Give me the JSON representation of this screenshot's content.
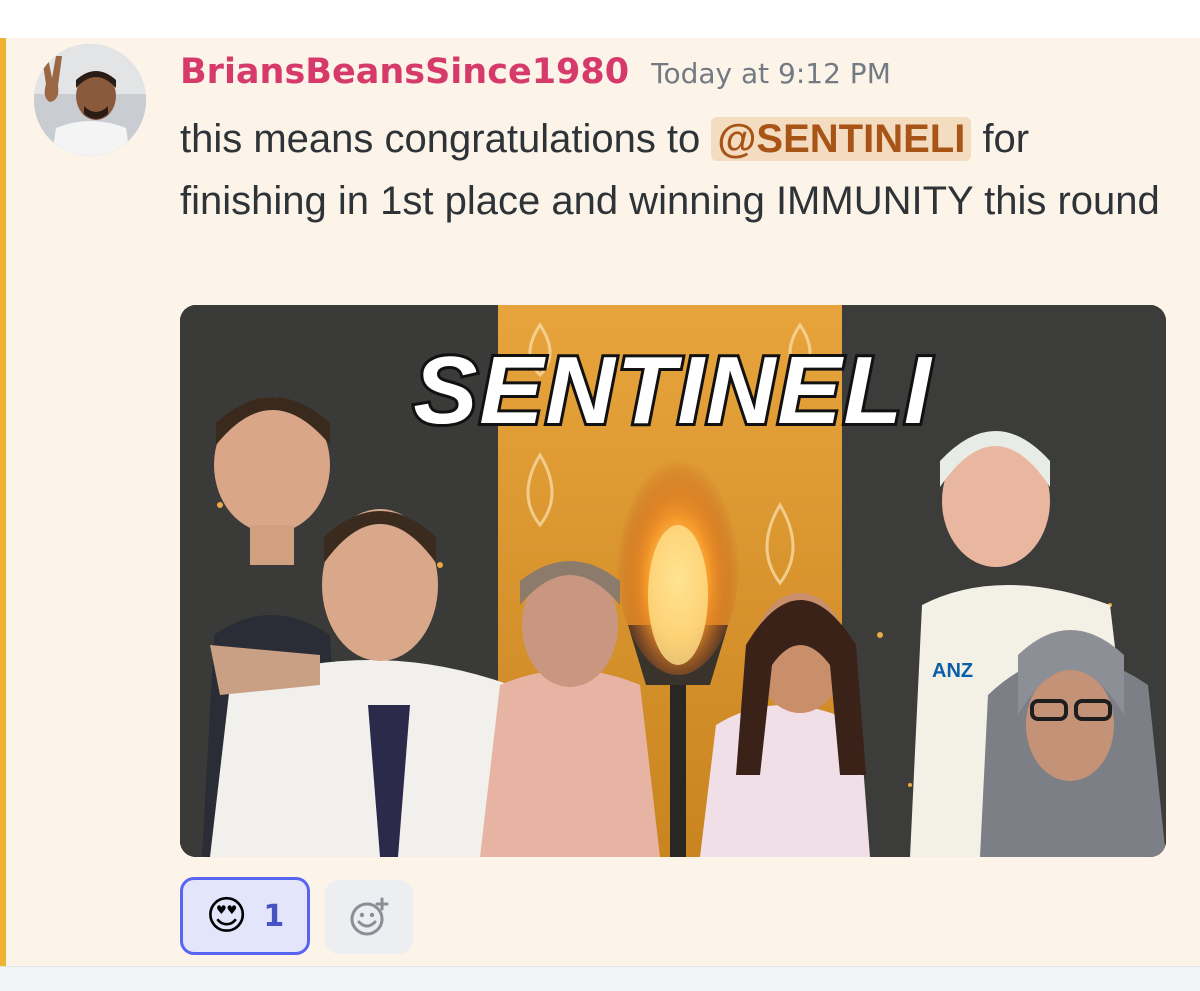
{
  "message": {
    "author": "BriansBeansSince1980",
    "timestamp": "Today at 9:12 PM",
    "text_before_mention": "this means congratulations to ",
    "mention": "@SENTINELI",
    "text_after_mention": "  for finishing in 1st place and winning IMMUNITY this round"
  },
  "embed": {
    "title_text": "SENTINELI",
    "shirt_logo_text": "ANZ"
  },
  "reaction": {
    "emoji": "😍",
    "count": "1"
  },
  "icons": {
    "avatar": "avatar",
    "add_reaction": "add-reaction-icon"
  },
  "colors": {
    "author": "#d63a6a",
    "mention_bg": "#f3dcc0",
    "mention_text": "#a85416",
    "highlight_bar": "#f0b232",
    "reaction_border": "#5865f2"
  }
}
